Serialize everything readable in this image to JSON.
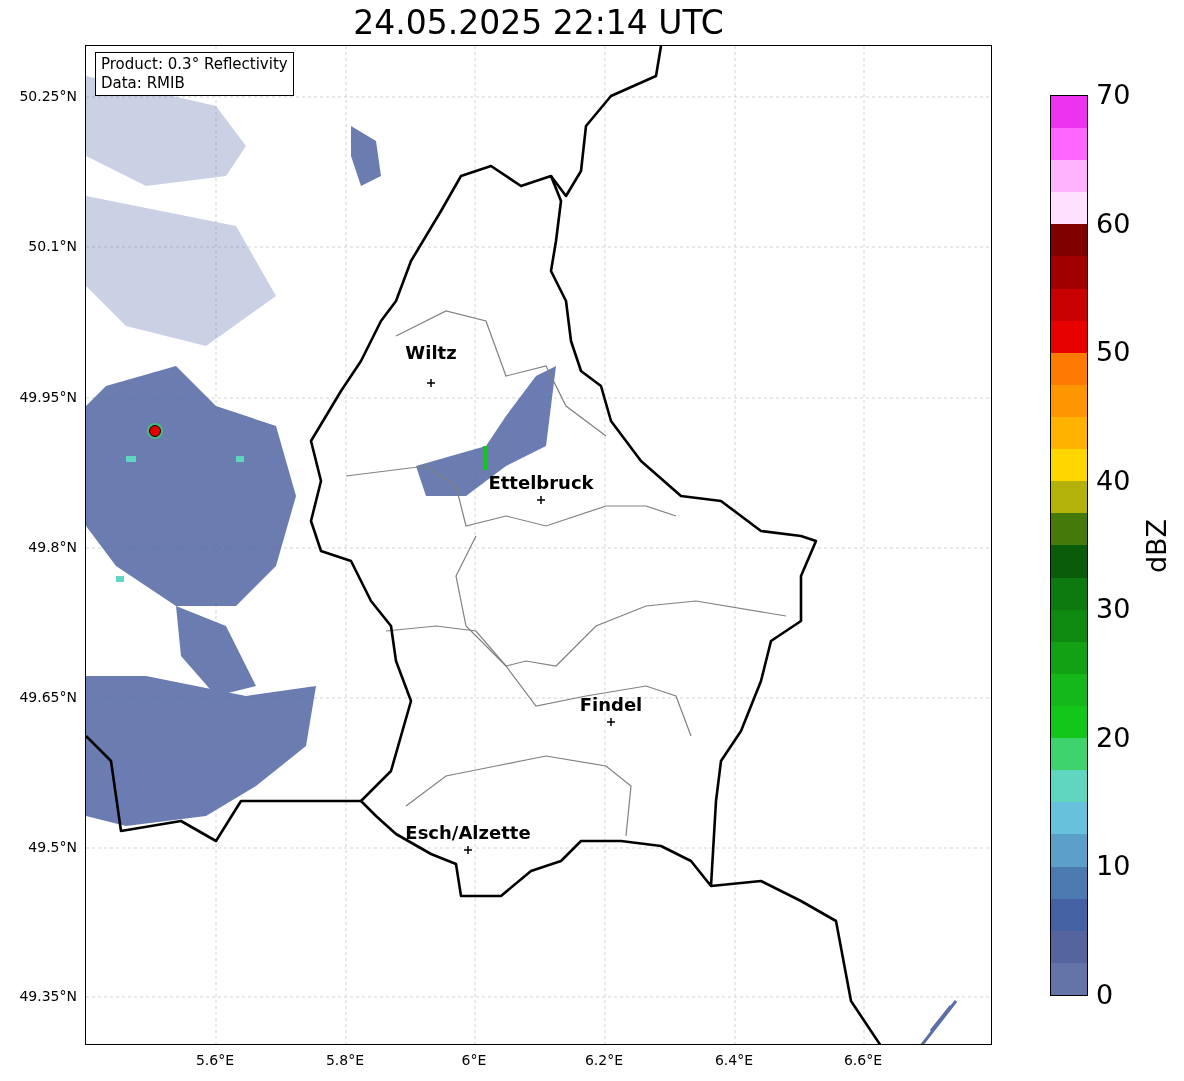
{
  "title": "24.05.2025 22:14 UTC",
  "info_box": [
    "Product: 0.3° Reflectivity",
    "Data: RMIB"
  ],
  "map": {
    "y_ticks": [
      "50.25°N",
      "50.1°N",
      "49.95°N",
      "49.8°N",
      "49.65°N",
      "49.5°N",
      "49.35°N"
    ],
    "x_ticks": [
      "5.6°E",
      "5.8°E",
      "6°E",
      "6.2°E",
      "6.4°E",
      "6.6°E"
    ],
    "cities": [
      {
        "name": "Wiltz"
      },
      {
        "name": "Ettelbruck"
      },
      {
        "name": "Findel"
      },
      {
        "name": "Esch/Alzette"
      }
    ]
  },
  "colorbar": {
    "label": "dBZ",
    "ticks": [
      "70",
      "60",
      "50",
      "40",
      "30",
      "20",
      "10",
      "0"
    ],
    "segments": [
      {
        "color": "#6473a8"
      },
      {
        "color": "#56649e"
      },
      {
        "color": "#4361a3"
      },
      {
        "color": "#4a7ab0"
      },
      {
        "color": "#5aa0c8"
      },
      {
        "color": "#66c2dc"
      },
      {
        "color": "#5fd7c0"
      },
      {
        "color": "#3ed36c"
      },
      {
        "color": "#12c71a"
      },
      {
        "color": "#14b81a"
      },
      {
        "color": "#12a015"
      },
      {
        "color": "#0f8a10"
      },
      {
        "color": "#0d7a10"
      },
      {
        "color": "#0b5c0a"
      },
      {
        "color": "#457a0a"
      },
      {
        "color": "#b2b20a"
      },
      {
        "color": "#ffd700"
      },
      {
        "color": "#ffb300"
      },
      {
        "color": "#ff9600"
      },
      {
        "color": "#ff7a00"
      },
      {
        "color": "#e60000"
      },
      {
        "color": "#c80000"
      },
      {
        "color": "#a00000"
      },
      {
        "color": "#800000"
      },
      {
        "color": "#ffe0ff"
      },
      {
        "color": "#ffb3ff"
      },
      {
        "color": "#ff66ff"
      },
      {
        "color": "#ee33ee"
      }
    ]
  }
}
